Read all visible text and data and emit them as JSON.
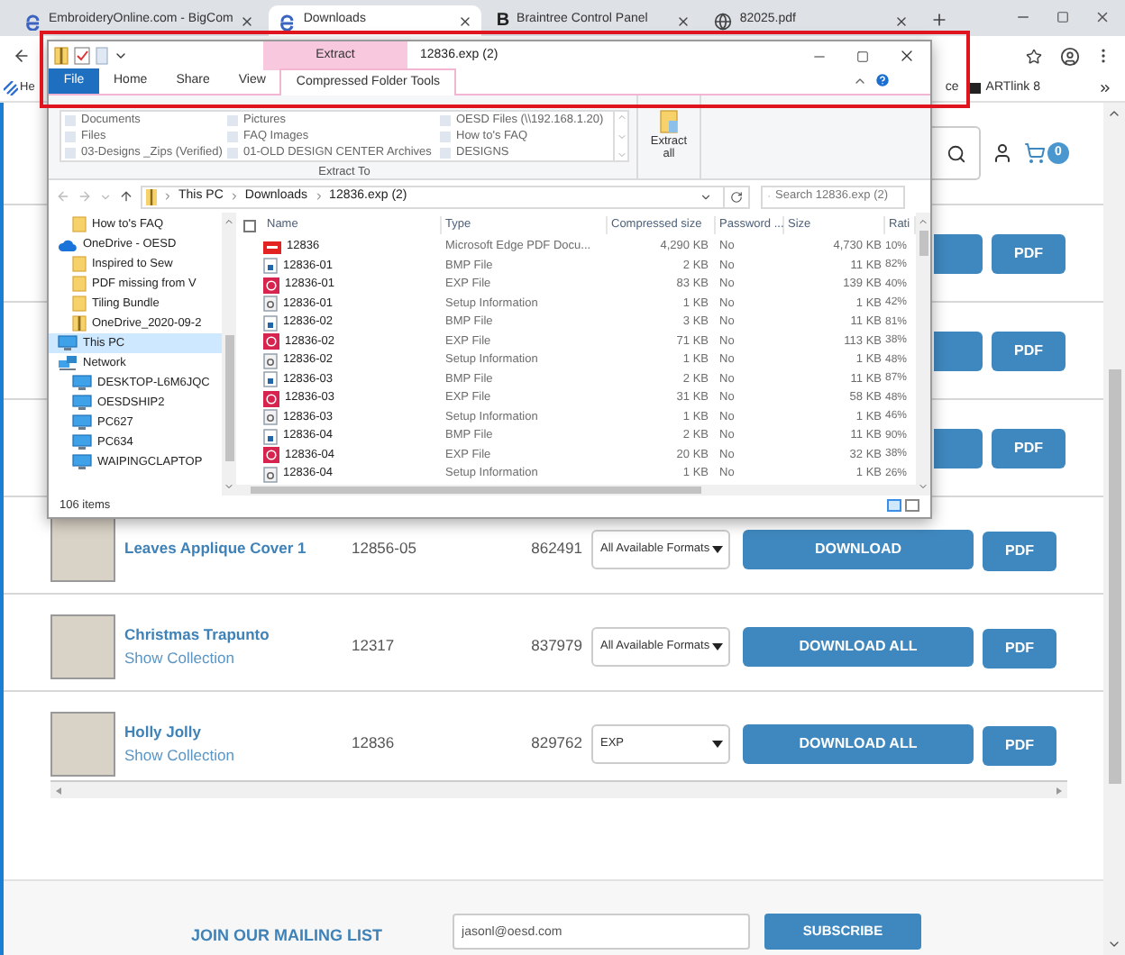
{
  "browser": {
    "tabs": [
      {
        "title": "EmbroideryOnline.com - BigCom",
        "kind": "edge",
        "selected": false
      },
      {
        "title": "Downloads",
        "kind": "edge",
        "selected": true
      },
      {
        "title": "Braintree Control Panel",
        "kind": "letter",
        "logo": "B",
        "selected": false
      },
      {
        "title": "82025.pdf",
        "kind": "globe",
        "selected": false
      }
    ],
    "bookmarks_left": [
      {
        "label": "He"
      }
    ],
    "bookmarks_right": [
      {
        "label": "ce",
        "kind": "plain"
      },
      {
        "label": "ARTlink 8",
        "kind": "app"
      }
    ]
  },
  "site": {
    "cart_count": "0",
    "rows": [
      {
        "kind": "hidden",
        "pdf": "PDF"
      },
      {
        "kind": "hidden",
        "pdf": "PDF"
      },
      {
        "kind": "hidden",
        "pdf": "PDF"
      },
      {
        "kind": "full",
        "title": "Leaves Applique Cover 1",
        "sku": "12856-05",
        "number": "862491",
        "format": "All Available Formats",
        "download": "DOWNLOAD",
        "pdf": "PDF"
      },
      {
        "kind": "full",
        "title": "Christmas Trapunto",
        "link": "Show Collection",
        "sku": "12317",
        "number": "837979",
        "format": "All Available Formats",
        "download": "DOWNLOAD ALL",
        "pdf": "PDF"
      },
      {
        "kind": "full",
        "title": "Holly Jolly",
        "link": "Show Collection",
        "sku": "12836",
        "number": "829762",
        "format": "EXP",
        "download": "DOWNLOAD ALL",
        "pdf": "PDF"
      }
    ],
    "mailing": {
      "title": "JOIN OUR MAILING LIST",
      "email": "jasonl@oesd.com",
      "button": "SUBSCRIBE"
    }
  },
  "explorer": {
    "context_tab": "Extract",
    "title": "12836.exp (2)",
    "ribbon_tabs": [
      {
        "label": "File",
        "kind": "file",
        "selected": false
      },
      {
        "label": "Home",
        "kind": "tab",
        "selected": false
      },
      {
        "label": "Share",
        "kind": "tab",
        "selected": false
      },
      {
        "label": "View",
        "kind": "tab",
        "selected": false
      },
      {
        "label": "Compressed Folder Tools",
        "kind": "tab",
        "selected": true
      }
    ],
    "extract_to": {
      "items": [
        "Documents",
        "Pictures",
        "OESD Files (\\\\192.168.1.20)",
        "Files",
        "FAQ Images",
        "How to's  FAQ",
        "03-Designs _Zips (Verified)",
        "01-OLD DESIGN CENTER Archives",
        "DESIGNS"
      ],
      "label": "Extract To"
    },
    "extract_all": "Extract all",
    "breadcrumb": [
      "This PC",
      "Downloads",
      "12836.exp (2)"
    ],
    "search": {
      "placeholder": "Search 12836.exp (2)"
    },
    "nav": [
      {
        "label": "How to's  FAQ",
        "kind": "folder",
        "selected": false
      },
      {
        "label": "OneDrive - OESD",
        "kind": "cloud",
        "selected": false,
        "children": [
          {
            "label": "Inspired to Sew",
            "kind": "folder",
            "selected": false
          },
          {
            "label": "PDF missing from V",
            "kind": "folder",
            "selected": false
          },
          {
            "label": "Tiling Bundle",
            "kind": "folder",
            "selected": false
          },
          {
            "label": "OneDrive_2020-09-2",
            "kind": "zip",
            "selected": false
          }
        ]
      },
      {
        "label": "This PC",
        "kind": "computer",
        "selected": true
      },
      {
        "label": "Network",
        "kind": "network",
        "selected": false,
        "children": [
          {
            "label": "DESKTOP-L6M6JQC",
            "kind": "pc",
            "selected": false
          },
          {
            "label": "OESDSHIP2",
            "kind": "pc",
            "selected": false
          },
          {
            "label": "PC627",
            "kind": "pc",
            "selected": false
          },
          {
            "label": "PC634",
            "kind": "pc",
            "selected": false
          },
          {
            "label": "WAIPINGCLAPTOP",
            "kind": "pc",
            "selected": false
          }
        ]
      }
    ],
    "select_all": {
      "checked": false
    },
    "columns": [
      "Name",
      "Type",
      "Compressed size",
      "Password ...",
      "Size",
      "Rati"
    ],
    "files": [
      {
        "kind": "pdf",
        "name": "12836",
        "type": "Microsoft Edge PDF Docu...",
        "compressed": "4,290 KB",
        "password": "No",
        "size": "4,730 KB",
        "ratio": "10%"
      },
      {
        "kind": "bmp",
        "name": "12836-01",
        "type": "BMP File",
        "compressed": "2 KB",
        "password": "No",
        "size": "11 KB",
        "ratio": "82%"
      },
      {
        "kind": "exp",
        "name": "12836-01",
        "type": "EXP File",
        "compressed": "83 KB",
        "password": "No",
        "size": "139 KB",
        "ratio": "40%"
      },
      {
        "kind": "inf",
        "name": "12836-01",
        "type": "Setup Information",
        "compressed": "1 KB",
        "password": "No",
        "size": "1 KB",
        "ratio": "42%"
      },
      {
        "kind": "bmp",
        "name": "12836-02",
        "type": "BMP File",
        "compressed": "3 KB",
        "password": "No",
        "size": "11 KB",
        "ratio": "81%"
      },
      {
        "kind": "exp",
        "name": "12836-02",
        "type": "EXP File",
        "compressed": "71 KB",
        "password": "No",
        "size": "113 KB",
        "ratio": "38%"
      },
      {
        "kind": "inf",
        "name": "12836-02",
        "type": "Setup Information",
        "compressed": "1 KB",
        "password": "No",
        "size": "1 KB",
        "ratio": "48%"
      },
      {
        "kind": "bmp",
        "name": "12836-03",
        "type": "BMP File",
        "compressed": "2 KB",
        "password": "No",
        "size": "11 KB",
        "ratio": "87%"
      },
      {
        "kind": "exp",
        "name": "12836-03",
        "type": "EXP File",
        "compressed": "31 KB",
        "password": "No",
        "size": "58 KB",
        "ratio": "48%"
      },
      {
        "kind": "inf",
        "name": "12836-03",
        "type": "Setup Information",
        "compressed": "1 KB",
        "password": "No",
        "size": "1 KB",
        "ratio": "46%"
      },
      {
        "kind": "bmp",
        "name": "12836-04",
        "type": "BMP File",
        "compressed": "2 KB",
        "password": "No",
        "size": "11 KB",
        "ratio": "90%"
      },
      {
        "kind": "exp",
        "name": "12836-04",
        "type": "EXP File",
        "compressed": "20 KB",
        "password": "No",
        "size": "32 KB",
        "ratio": "38%"
      },
      {
        "kind": "inf",
        "name": "12836-04",
        "type": "Setup Information",
        "compressed": "1 KB",
        "password": "No",
        "size": "1 KB",
        "ratio": "26%"
      }
    ],
    "status": "106 items"
  }
}
